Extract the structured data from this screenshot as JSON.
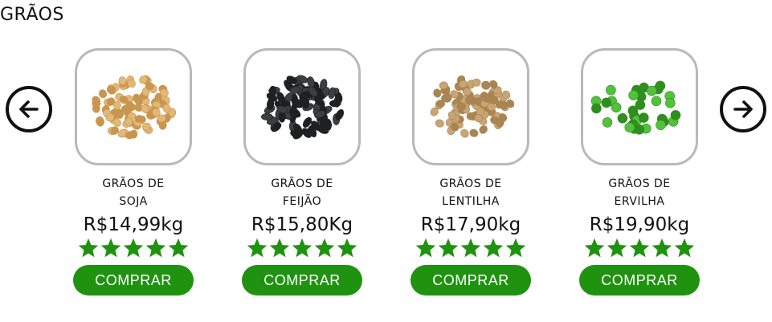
{
  "section": {
    "title": "GRÃOS"
  },
  "products": [
    {
      "name_line1": "GRÃOS DE",
      "name_line2": "SOJA",
      "price": "R$14,99kg",
      "rating": 5,
      "button": "COMPRAR",
      "image_icon": "soybeans-image",
      "grain_color": "#e2b877",
      "grain_shade": "#c9964f"
    },
    {
      "name_line1": "GRÃOS DE",
      "name_line2": "FEIJÃO",
      "price": "R$15,80Kg",
      "rating": 5,
      "button": "COMPRAR",
      "image_icon": "black-beans-image",
      "grain_color": "#3c3f40",
      "grain_shade": "#1e2021"
    },
    {
      "name_line1": "GRÃOS DE",
      "name_line2": "LENTILHA",
      "price": "R$17,90kg",
      "rating": 5,
      "button": "COMPRAR",
      "image_icon": "lentils-image",
      "grain_color": "#c8a574",
      "grain_shade": "#a88552"
    },
    {
      "name_line1": "GRÃOS DE",
      "name_line2": "ERVILHA",
      "price": "R$19,90kg",
      "rating": 5,
      "button": "COMPRAR",
      "image_icon": "peas-image",
      "grain_color": "#52c23a",
      "grain_shade": "#2f8f1e"
    }
  ],
  "colors": {
    "star": "#1f9310",
    "button": "#1f9310",
    "border": "#b9b9b9"
  },
  "icons": {
    "prev": "arrow-left-circle-icon",
    "next": "arrow-right-circle-icon",
    "star": "star-icon"
  }
}
